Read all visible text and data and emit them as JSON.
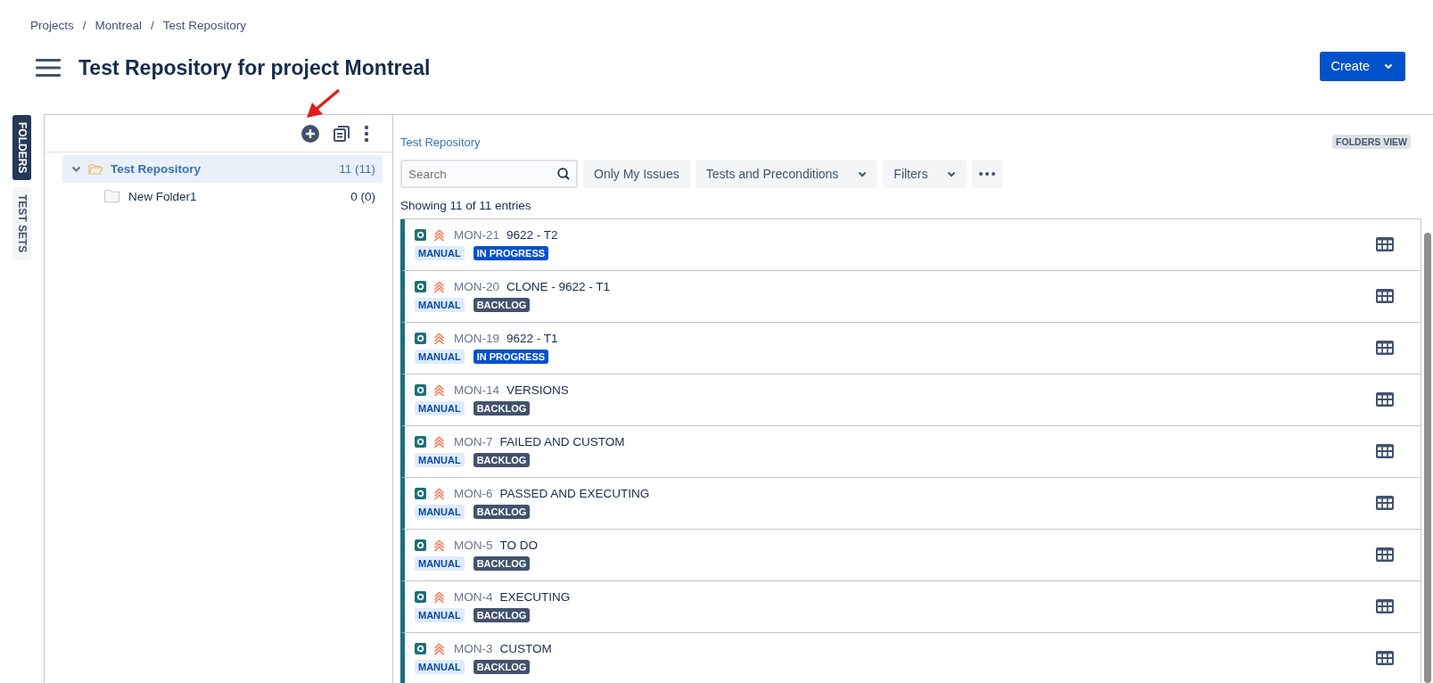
{
  "breadcrumbs": [
    "Projects",
    "Montreal",
    "Test Repository"
  ],
  "breadcrumb_separator": "/",
  "title": "Test Repository for project Montreal",
  "create_button": "Create",
  "side_tabs": [
    {
      "label": "FOLDERS",
      "selected": true
    },
    {
      "label": "TEST SETS",
      "selected": false
    }
  ],
  "tree": [
    {
      "name": "Test Repository",
      "count": "11 (11)",
      "selected": true,
      "expanded": true,
      "children": [
        {
          "name": "New Folder1",
          "count": "0 (0)",
          "selected": false
        }
      ]
    }
  ],
  "panel": {
    "path": "Test Repository",
    "view_badge": "FOLDERS VIEW",
    "search": {
      "placeholder": "Search"
    },
    "filters": [
      {
        "label": "Only My Issues",
        "kind": "toggle"
      },
      {
        "label": "Tests and Preconditions",
        "kind": "dropdown"
      },
      {
        "label": "Filters",
        "kind": "dropdown"
      }
    ],
    "summary": "Showing 11 of 11 entries"
  },
  "issues": [
    {
      "key": "MON-21",
      "summary": "9622 - T2",
      "type": "MANUAL",
      "status": "IN PROGRESS",
      "kind": "in_progress"
    },
    {
      "key": "MON-20",
      "summary": "CLONE - 9622 - T1",
      "type": "MANUAL",
      "status": "BACKLOG",
      "kind": "backlog"
    },
    {
      "key": "MON-19",
      "summary": "9622 - T1",
      "type": "MANUAL",
      "status": "IN PROGRESS",
      "kind": "in_progress"
    },
    {
      "key": "MON-14",
      "summary": "VERSIONS",
      "type": "MANUAL",
      "status": "BACKLOG",
      "kind": "backlog"
    },
    {
      "key": "MON-7",
      "summary": "FAILED AND CUSTOM",
      "type": "MANUAL",
      "status": "BACKLOG",
      "kind": "backlog"
    },
    {
      "key": "MON-6",
      "summary": "PASSED AND EXECUTING",
      "type": "MANUAL",
      "status": "BACKLOG",
      "kind": "backlog"
    },
    {
      "key": "MON-5",
      "summary": "TO DO",
      "type": "MANUAL",
      "status": "BACKLOG",
      "kind": "backlog"
    },
    {
      "key": "MON-4",
      "summary": "EXECUTING",
      "type": "MANUAL",
      "status": "BACKLOG",
      "kind": "backlog"
    },
    {
      "key": "MON-3",
      "summary": "CUSTOM",
      "type": "MANUAL",
      "status": "BACKLOG",
      "kind": "backlog"
    }
  ]
}
